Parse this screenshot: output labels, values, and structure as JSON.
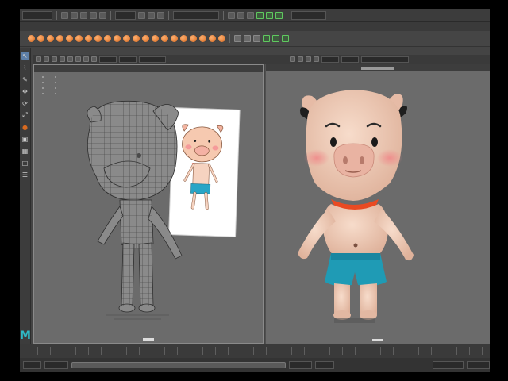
{
  "colors": {
    "background": "#444444",
    "viewport": "#6b6b6b",
    "accent_orange": "#d86a20",
    "accent_green": "#5fc95f",
    "maya_logo": "#2fb8c4",
    "active_tool": "#5d7fa8"
  },
  "app": {
    "logo_text": "M"
  },
  "menubar": {
    "menu_set_field": "",
    "icons": [
      "new-scene-icon",
      "open-scene-icon",
      "save-scene-icon",
      "undo-icon",
      "redo-icon",
      "select-by-hierarchy-icon",
      "select-by-object-icon",
      "select-by-component-icon",
      "snap-grid-icon",
      "snap-curve-icon",
      "snap-point-icon",
      "render-icon",
      "ipr-render-icon",
      "render-settings-icon"
    ]
  },
  "shelf": {
    "tab_labels": [],
    "icons": [
      "sphere-icon",
      "cube-icon",
      "cylinder-icon",
      "cone-icon",
      "torus-icon",
      "plane-icon",
      "disc-icon",
      "platonic-icon",
      "pyramid-icon",
      "prism-icon",
      "pipe-icon",
      "helix-icon",
      "gear-icon",
      "soccer-ball-icon",
      "superellipse-icon",
      "sphere-icon",
      "combine-icon",
      "separate-icon",
      "extrude-icon",
      "bridge-icon",
      "bevel-icon"
    ]
  },
  "toolbox": {
    "tools": [
      {
        "name": "select-tool-icon",
        "glyph": "↖",
        "active": true
      },
      {
        "name": "lasso-tool-icon",
        "glyph": "⌇",
        "active": false
      },
      {
        "name": "paint-select-tool-icon",
        "glyph": "✎",
        "active": false
      },
      {
        "name": "move-tool-icon",
        "glyph": "✥",
        "active": false
      },
      {
        "name": "rotate-tool-icon",
        "glyph": "⟳",
        "active": false
      },
      {
        "name": "scale-tool-icon",
        "glyph": "⤢",
        "active": false
      },
      {
        "name": "last-tool-icon",
        "glyph": "●",
        "active": false
      },
      {
        "name": "layout-single-icon",
        "glyph": "▣",
        "active": false
      },
      {
        "name": "layout-four-icon",
        "glyph": "▦",
        "active": false
      },
      {
        "name": "layout-side-icon",
        "glyph": "◫",
        "active": false
      },
      {
        "name": "layout-stack-icon",
        "glyph": "☰",
        "active": false
      }
    ]
  },
  "panel": {
    "menu_items": [],
    "toolbar_icons": [
      "camera-icon",
      "bookmark-icon",
      "image-plane-icon",
      "grid-icon",
      "film-gate-icon",
      "wireframe-icon",
      "smooth-shade-icon",
      "textured-icon",
      "lights-icon",
      "shadows-icon",
      "isolate-icon",
      "xray-icon"
    ]
  },
  "viewports": {
    "left": {
      "header_labels": [],
      "mode": "wireframe-on-shaded"
    },
    "right": {
      "header_label": "",
      "mode": "textured"
    }
  },
  "timeline": {
    "start_field": "",
    "end_field": ""
  }
}
